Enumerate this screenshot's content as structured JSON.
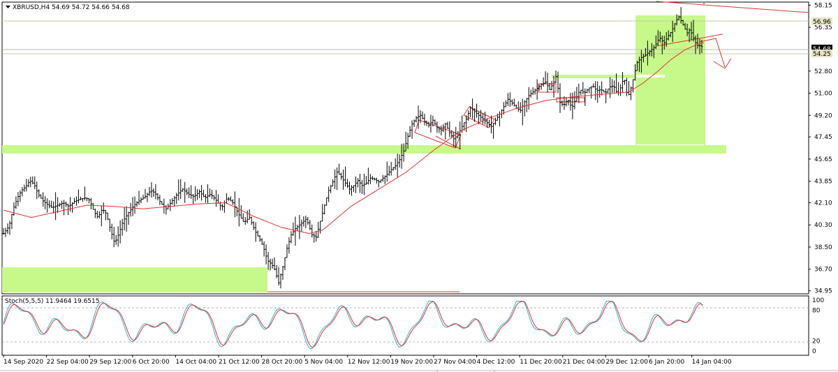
{
  "chart_data": [
    {
      "type": "candlestick",
      "symbol_label": "XBRUSD,H4",
      "ohlc_readout": "54.69 54.72 54.66 54.68",
      "x_tick_labels": [
        "14 Sep 2020",
        "22 Sep 04:00",
        "29 Sep 12:00",
        "6 Oct 20:00",
        "14 Oct 04:00",
        "21 Oct 12:00",
        "28 Oct 20:00",
        "5 Nov 04:00",
        "12 Nov 12:00",
        "19 Nov 20:00",
        "27 Nov 04:00",
        "4 Dec 12:00",
        "11 Dec 20:00",
        "21 Dec 04:00",
        "29 Dec 12:00",
        "6 Jan 20:00",
        "14 Jan 04:00"
      ],
      "y_tick_labels": [
        "58.15",
        "56.35",
        "54.68",
        "54.25",
        "52.80",
        "51.00",
        "49.20",
        "47.45",
        "45.65",
        "43.85",
        "42.10",
        "40.30",
        "38.50",
        "36.70",
        "34.95"
      ],
      "ylim": [
        34.7,
        58.4
      ],
      "current_price": 54.68,
      "highlighted_levels": [
        56.96,
        54.25
      ],
      "price_path": [
        [
          0,
          39.6
        ],
        [
          8,
          40.2
        ],
        [
          14,
          41.6
        ],
        [
          20,
          42.5
        ],
        [
          26,
          43.1
        ],
        [
          32,
          43.4
        ],
        [
          38,
          43.9
        ],
        [
          44,
          43.6
        ],
        [
          50,
          42.8
        ],
        [
          56,
          42.3
        ],
        [
          62,
          42.0
        ],
        [
          70,
          41.7
        ],
        [
          78,
          41.9
        ],
        [
          86,
          42.1
        ],
        [
          94,
          41.8
        ],
        [
          102,
          42.2
        ],
        [
          110,
          42.4
        ],
        [
          118,
          42.5
        ],
        [
          124,
          42.3
        ],
        [
          130,
          41.4
        ],
        [
          136,
          40.9
        ],
        [
          142,
          41.6
        ],
        [
          148,
          41.2
        ],
        [
          154,
          39.9
        ],
        [
          160,
          38.8
        ],
        [
          166,
          39.6
        ],
        [
          172,
          40.6
        ],
        [
          180,
          41.3
        ],
        [
          188,
          41.9
        ],
        [
          196,
          42.3
        ],
        [
          204,
          42.6
        ],
        [
          212,
          43.1
        ],
        [
          218,
          42.9
        ],
        [
          226,
          42.1
        ],
        [
          234,
          41.6
        ],
        [
          242,
          42.2
        ],
        [
          250,
          42.8
        ],
        [
          258,
          43.2
        ],
        [
          266,
          42.8
        ],
        [
          274,
          42.6
        ],
        [
          282,
          43.0
        ],
        [
          290,
          42.5
        ],
        [
          298,
          42.8
        ],
        [
          306,
          42.3
        ],
        [
          314,
          41.7
        ],
        [
          322,
          42.5
        ],
        [
          330,
          42.1
        ],
        [
          338,
          41.2
        ],
        [
          346,
          40.5
        ],
        [
          354,
          40.9
        ],
        [
          362,
          39.8
        ],
        [
          368,
          39.2
        ],
        [
          374,
          38.5
        ],
        [
          380,
          37.4
        ],
        [
          386,
          37.1
        ],
        [
          390,
          36.7
        ],
        [
          396,
          35.6
        ],
        [
          402,
          36.9
        ],
        [
          408,
          38.4
        ],
        [
          414,
          39.5
        ],
        [
          420,
          40.0
        ],
        [
          428,
          40.4
        ],
        [
          436,
          40.8
        ],
        [
          444,
          39.5
        ],
        [
          450,
          39.3
        ],
        [
          456,
          40.6
        ],
        [
          462,
          41.9
        ],
        [
          468,
          43.1
        ],
        [
          474,
          43.8
        ],
        [
          480,
          44.6
        ],
        [
          486,
          44.2
        ],
        [
          492,
          43.7
        ],
        [
          498,
          43.2
        ],
        [
          504,
          43.5
        ],
        [
          510,
          43.9
        ],
        [
          516,
          43.5
        ],
        [
          522,
          43.7
        ],
        [
          528,
          44.1
        ],
        [
          534,
          44.0
        ],
        [
          540,
          43.8
        ],
        [
          546,
          44.1
        ],
        [
          552,
          44.4
        ],
        [
          558,
          44.8
        ],
        [
          564,
          45.1
        ],
        [
          570,
          45.6
        ],
        [
          576,
          46.3
        ],
        [
          582,
          47.5
        ],
        [
          588,
          48.5
        ],
        [
          594,
          49.0
        ],
        [
          600,
          49.2
        ],
        [
          606,
          48.7
        ],
        [
          612,
          48.4
        ],
        [
          618,
          48.8
        ],
        [
          624,
          48.2
        ],
        [
          630,
          48.0
        ],
        [
          636,
          48.5
        ],
        [
          642,
          47.8
        ],
        [
          648,
          47.3
        ],
        [
          654,
          47.6
        ],
        [
          660,
          48.3
        ],
        [
          666,
          48.9
        ],
        [
          672,
          49.8
        ],
        [
          678,
          49.5
        ],
        [
          684,
          49.2
        ],
        [
          690,
          48.9
        ],
        [
          696,
          48.6
        ],
        [
          702,
          48.3
        ],
        [
          708,
          48.8
        ],
        [
          714,
          49.3
        ],
        [
          720,
          49.9
        ],
        [
          726,
          50.5
        ],
        [
          732,
          50.2
        ],
        [
          738,
          49.8
        ],
        [
          744,
          49.6
        ],
        [
          750,
          50.3
        ],
        [
          756,
          50.8
        ],
        [
          762,
          51.1
        ],
        [
          768,
          51.4
        ],
        [
          774,
          51.7
        ],
        [
          780,
          51.9
        ],
        [
          786,
          51.3
        ],
        [
          792,
          51.9
        ],
        [
          796,
          52.5
        ],
        [
          800,
          50.3
        ],
        [
          806,
          50.0
        ],
        [
          812,
          50.5
        ],
        [
          818,
          49.8
        ],
        [
          824,
          50.6
        ],
        [
          830,
          51.3
        ],
        [
          836,
          51.0
        ],
        [
          842,
          51.4
        ],
        [
          848,
          51.6
        ],
        [
          854,
          51.2
        ],
        [
          860,
          51.3
        ],
        [
          866,
          51.0
        ],
        [
          872,
          51.5
        ],
        [
          878,
          51.6
        ],
        [
          884,
          50.9
        ],
        [
          890,
          51.7
        ],
        [
          893,
          52.5
        ],
        [
          896,
          51.1
        ],
        [
          900,
          50.9
        ],
        [
          904,
          51.6
        ],
        [
          908,
          52.6
        ],
        [
          912,
          53.5
        ],
        [
          918,
          53.9
        ],
        [
          924,
          54.1
        ],
        [
          930,
          54.4
        ],
        [
          936,
          54.7
        ],
        [
          942,
          55.3
        ],
        [
          946,
          55.5
        ],
        [
          950,
          55.0
        ],
        [
          956,
          55.6
        ],
        [
          962,
          56.1
        ],
        [
          968,
          56.9
        ],
        [
          972,
          57.2
        ],
        [
          976,
          56.8
        ],
        [
          980,
          56.3
        ],
        [
          984,
          55.9
        ],
        [
          988,
          56.2
        ],
        [
          992,
          55.6
        ],
        [
          996,
          55.1
        ],
        [
          1000,
          54.8
        ],
        [
          1004,
          54.9
        ],
        [
          1006,
          54.68
        ]
      ],
      "moving_average": [
        [
          0,
          41.5
        ],
        [
          40,
          40.9
        ],
        [
          80,
          41.4
        ],
        [
          120,
          41.9
        ],
        [
          160,
          41.8
        ],
        [
          200,
          41.6
        ],
        [
          240,
          41.8
        ],
        [
          280,
          42.0
        ],
        [
          320,
          42.1
        ],
        [
          360,
          41.0
        ],
        [
          400,
          40.1
        ],
        [
          440,
          39.6
        ],
        [
          460,
          39.9
        ],
        [
          500,
          41.8
        ],
        [
          540,
          43.2
        ],
        [
          580,
          44.6
        ],
        [
          620,
          46.4
        ],
        [
          660,
          48.0
        ],
        [
          700,
          49.0
        ],
        [
          740,
          49.8
        ],
        [
          780,
          50.4
        ],
        [
          820,
          50.7
        ],
        [
          860,
          50.9
        ],
        [
          900,
          51.1
        ],
        [
          920,
          51.8
        ],
        [
          940,
          52.7
        ],
        [
          960,
          53.7
        ],
        [
          980,
          54.5
        ],
        [
          1000,
          55.0
        ],
        [
          1008,
          55.1
        ]
      ]
    },
    {
      "type": "line",
      "indicator_label": "Stoch(5,5,5) 11.9464 19.6515",
      "ylim": [
        0,
        100
      ],
      "y_tick_labels": [
        "100",
        "80",
        "20",
        "0"
      ]
    }
  ]
}
